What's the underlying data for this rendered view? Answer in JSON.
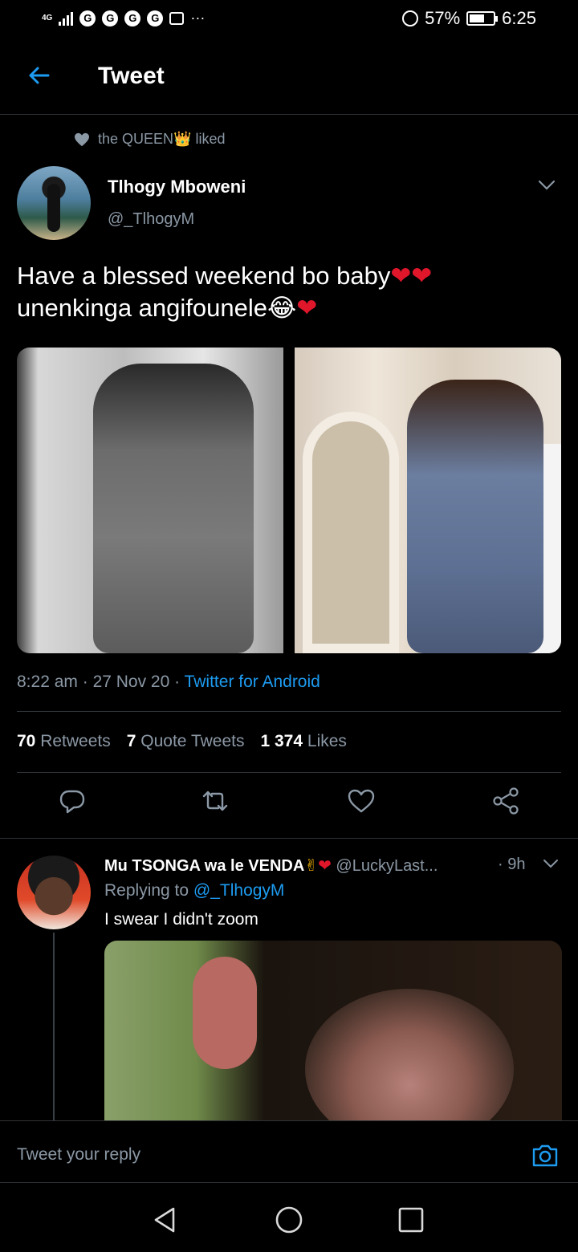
{
  "status_bar": {
    "network": "4G",
    "battery": "57%",
    "time": "6:25"
  },
  "header": {
    "title": "Tweet"
  },
  "social_context": {
    "text": "the QUEEN",
    "suffix": "liked",
    "crown_emoji": "👑"
  },
  "tweet": {
    "author_name": "Tlhogy Mboweni",
    "author_handle": "@_TlhogyM",
    "text_line1": "Have a blessed weekend bo baby",
    "text_line2": "unenkinga angifounele",
    "hearts_line1": "❤❤",
    "emoji_line2": "😂",
    "heart_line2": "❤",
    "time": "8:22 am",
    "date": "27 Nov 20",
    "source": "Twitter for Android",
    "retweets": "70",
    "retweets_label": "Retweets",
    "quotes": "7",
    "quotes_label": "Quote Tweets",
    "likes": "1 374",
    "likes_label": "Likes"
  },
  "reply": {
    "name": "Mu TSONGA wa le VENDA",
    "name_emoji": "✌",
    "name_heart": "❤",
    "handle": "@LuckyLast...",
    "time": "· 9h",
    "replying_prefix": "Replying to",
    "replying_to": "@_TlhogyM",
    "text": "I swear  I didn't zoom"
  },
  "composer": {
    "placeholder": "Tweet your reply"
  },
  "colors": {
    "background": "#000000",
    "accent": "#1d9bf0",
    "secondary_text": "#8b98a5",
    "divider": "#2f3336",
    "heart": "#e0162b"
  }
}
